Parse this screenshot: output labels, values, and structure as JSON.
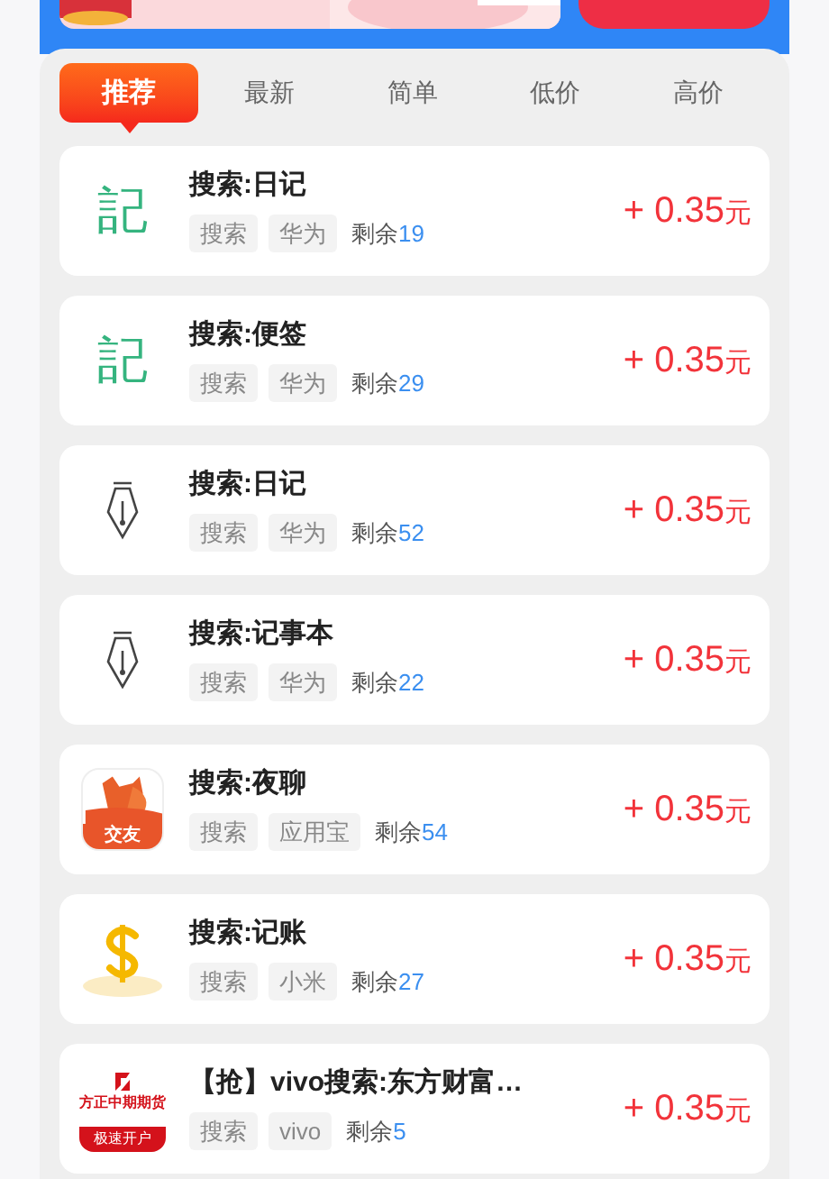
{
  "tabs": [
    {
      "label": "推荐",
      "selected": true
    },
    {
      "label": "最新",
      "selected": false
    },
    {
      "label": "简单",
      "selected": false
    },
    {
      "label": "低价",
      "selected": false
    },
    {
      "label": "高价",
      "selected": false
    }
  ],
  "tasks": [
    {
      "icon": {
        "kind": "glyph",
        "text": "記"
      },
      "title": "搜索:日记",
      "tags": [
        "搜索",
        "华为"
      ],
      "remaining_label": "剩余",
      "remaining": "19",
      "reward": "+ 0.35",
      "unit": "元"
    },
    {
      "icon": {
        "kind": "glyph",
        "text": "記"
      },
      "title": "搜索:便签",
      "tags": [
        "搜索",
        "华为"
      ],
      "remaining_label": "剩余",
      "remaining": "29",
      "reward": "+ 0.35",
      "unit": "元"
    },
    {
      "icon": {
        "kind": "pen"
      },
      "title": "搜索:日记",
      "tags": [
        "搜索",
        "华为"
      ],
      "remaining_label": "剩余",
      "remaining": "52",
      "reward": "+ 0.35",
      "unit": "元"
    },
    {
      "icon": {
        "kind": "pen"
      },
      "title": "搜索:记事本",
      "tags": [
        "搜索",
        "华为"
      ],
      "remaining_label": "剩余",
      "remaining": "22",
      "reward": "+ 0.35",
      "unit": "元"
    },
    {
      "icon": {
        "kind": "fox",
        "text": "交友"
      },
      "title": "搜索:夜聊",
      "tags": [
        "搜索",
        "应用宝"
      ],
      "remaining_label": "剩余",
      "remaining": "54",
      "reward": "+ 0.35",
      "unit": "元"
    },
    {
      "icon": {
        "kind": "dollar"
      },
      "title": "搜索:记账",
      "tags": [
        "搜索",
        "小米"
      ],
      "remaining_label": "剩余",
      "remaining": "27",
      "reward": "+ 0.35",
      "unit": "元"
    },
    {
      "icon": {
        "kind": "broker",
        "text": "方正中期期货",
        "subtext": "极速开户"
      },
      "title": "【抢】vivo搜索:东方财富…",
      "tags": [
        "搜索",
        "vivo"
      ],
      "remaining_label": "剩余",
      "remaining": "5",
      "reward": "+ 0.35",
      "unit": "元"
    }
  ]
}
